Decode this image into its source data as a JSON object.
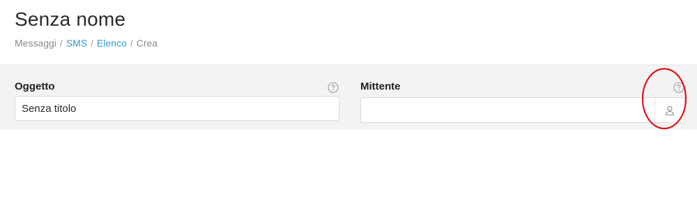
{
  "page": {
    "title": "Senza nome"
  },
  "breadcrumb": {
    "items": [
      {
        "label": "Messaggi",
        "link": false
      },
      {
        "label": "SMS",
        "link": true
      },
      {
        "label": "Elenco",
        "link": true
      },
      {
        "label": "Crea",
        "link": false
      }
    ],
    "separator": "/"
  },
  "form": {
    "oggetto": {
      "label": "Oggetto",
      "value": "Senza titolo"
    },
    "mittente": {
      "label": "Mittente",
      "value": ""
    }
  },
  "icons": {
    "help": "question-circle-icon",
    "contact": "user-icon"
  },
  "colors": {
    "link": "#2e9bd1",
    "annotation": "#e0141b"
  }
}
